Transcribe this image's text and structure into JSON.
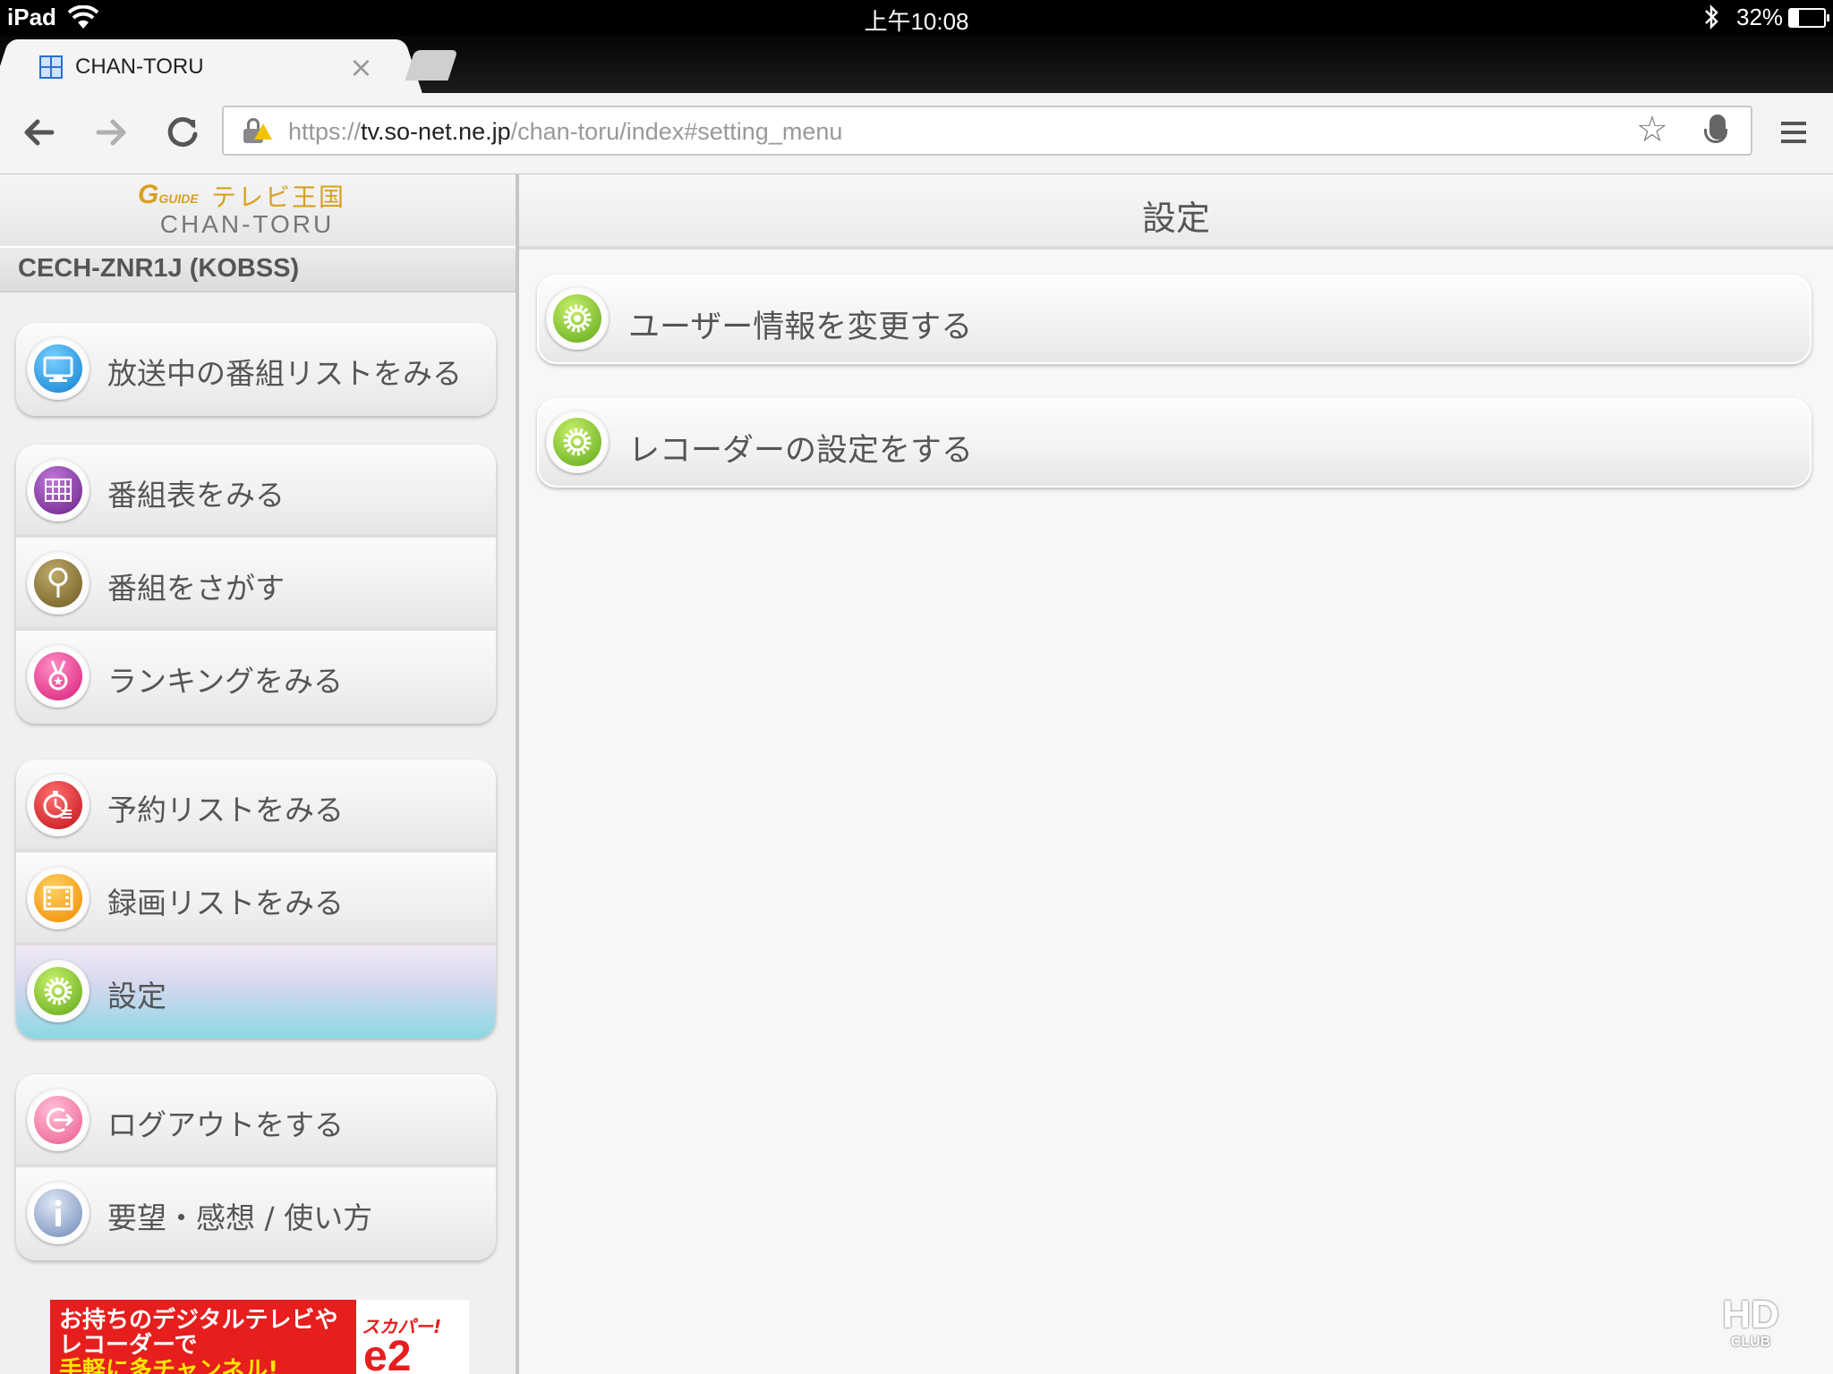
{
  "status_bar": {
    "device": "iPad",
    "time": "上午10:08",
    "battery": "32%"
  },
  "browser": {
    "tab_title": "CHAN-TORU",
    "url_scheme": "https://",
    "url_host": "tv.so-net.ne.jp",
    "url_path": "/chan-toru/index#setting_menu"
  },
  "sidebar": {
    "logo_guide": "GUIDE",
    "logo_brand": "テレビ王国",
    "logo_name": "CHAN-TORU",
    "device_name": "CECH-ZNR1J (KOBSS)",
    "groups": [
      [
        {
          "label": "放送中の番組リストをみる",
          "icon": "tv-icon",
          "color": "blue"
        }
      ],
      [
        {
          "label": "番組表をみる",
          "icon": "grid-icon",
          "color": "purple"
        },
        {
          "label": "番組をさがす",
          "icon": "magnifier-icon",
          "color": "olive"
        },
        {
          "label": "ランキングをみる",
          "icon": "medal-icon",
          "color": "pink"
        }
      ],
      [
        {
          "label": "予約リストをみる",
          "icon": "timer-icon",
          "color": "red"
        },
        {
          "label": "録画リストをみる",
          "icon": "film-icon",
          "color": "orange"
        },
        {
          "label": "設定",
          "icon": "gear-icon",
          "color": "green",
          "active": true
        }
      ],
      [
        {
          "label": "ログアウトをする",
          "icon": "logout-icon",
          "color": "pink-light"
        },
        {
          "label": "要望・感想 / 使い方",
          "icon": "info-icon",
          "color": "steel"
        }
      ]
    ],
    "banner": {
      "line1": "お持ちのデジタルテレビや",
      "line2": "レコーダーで",
      "line3": "手軽に多チャンネル!",
      "brand": "スカパー!",
      "brand_sub": "e2"
    }
  },
  "main": {
    "title": "設定",
    "items": [
      {
        "label": "ユーザー情報を変更する",
        "icon": "gear-icon"
      },
      {
        "label": "レコーダーの設定をする",
        "icon": "gear-icon"
      }
    ]
  },
  "watermark": {
    "big": "HD",
    "small": "CLUB"
  }
}
